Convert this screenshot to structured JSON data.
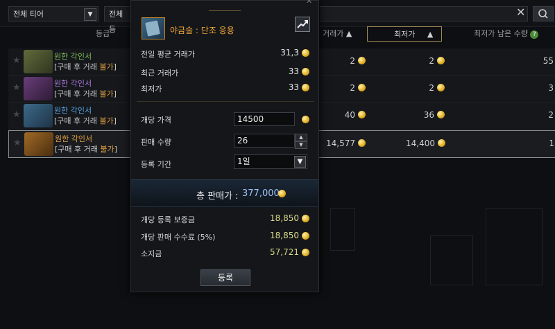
{
  "filters": {
    "tier": "전체 티어",
    "category": "전체 등"
  },
  "columns": {
    "grade": "등급",
    "recent": "거래가",
    "lowest": "최저가",
    "remaining": "최저가 남은 수량"
  },
  "rows": [
    {
      "name": "원한 각인서",
      "note": "[구매 후 거래 ",
      "note_em": "불가",
      "note_end": "]",
      "recent": "2",
      "lowest": "2",
      "remaining": "55",
      "name_color": "#7fc15a"
    },
    {
      "name": "원한 각인서",
      "note": "[구매 후 거래 ",
      "note_em": "불가",
      "note_end": "]",
      "recent": "2",
      "lowest": "2",
      "remaining": "3",
      "name_color": "#b07be0"
    },
    {
      "name": "원한 각인서",
      "note": "[구매 후 거래 ",
      "note_em": "불가",
      "note_end": "]",
      "recent": "40",
      "lowest": "36",
      "remaining": "2",
      "name_color": "#5aa6e6"
    },
    {
      "name": "원한 각인서",
      "note": "[구매 후 거래 ",
      "note_em": "불가",
      "note_end": "]",
      "recent": "14,577",
      "lowest": "14,400",
      "remaining": "1",
      "name_color": "#e0a040"
    }
  ],
  "modal": {
    "item_name": "야금술 : 단조 응용",
    "prev_avg_label": "전일 평균 거래가",
    "prev_avg_value": "31,3",
    "recent_label": "최근 거래가",
    "recent_value": "33",
    "lowest_label": "최저가",
    "lowest_value": "33",
    "unit_price_label": "개당 가격",
    "unit_price_value": "14500",
    "quantity_label": "판매 수량",
    "quantity_value": "26",
    "period_label": "등록 기간",
    "period_value": "1일",
    "total_label": "총 판매가 :",
    "total_value": "377,000",
    "deposit_label": "개당 등록 보증금",
    "deposit_value": "18,850",
    "fee_label": "개당 판매 수수료 (5%)",
    "fee_value": "18,850",
    "gold_label": "소지금",
    "gold_value": "57,721",
    "register_label": "등록"
  }
}
